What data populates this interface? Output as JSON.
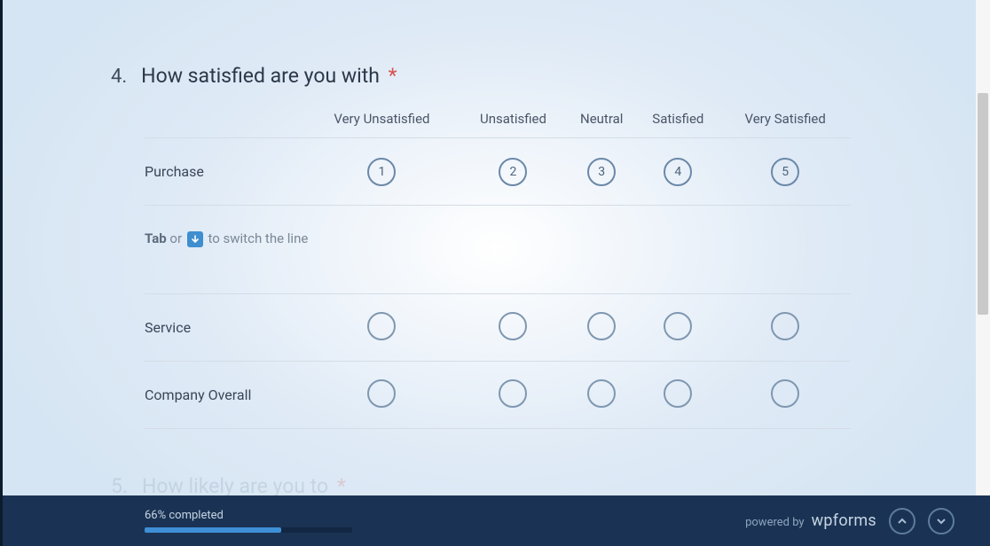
{
  "question": {
    "number": "4.",
    "text": "How satisfied are you with",
    "required_marker": "*",
    "columns": [
      "Very Unsatisfied",
      "Unsatisfied",
      "Neutral",
      "Satisfied",
      "Very Satisfied"
    ],
    "rows": [
      {
        "label": "Purchase",
        "numbered": true,
        "values": [
          "1",
          "2",
          "3",
          "4",
          "5"
        ]
      },
      {
        "label": "Service",
        "numbered": false
      },
      {
        "label": "Company Overall",
        "numbered": false
      }
    ],
    "hint": {
      "tab_word": "Tab",
      "or_word": " or ",
      "tail": " to switch the line"
    }
  },
  "next_question": {
    "number": "5.",
    "text": "How likely are you to",
    "required_marker": "*"
  },
  "footer": {
    "progress_label": "66% completed",
    "progress_percent": 66,
    "powered_by": "powered by",
    "brand": "wpforms"
  }
}
